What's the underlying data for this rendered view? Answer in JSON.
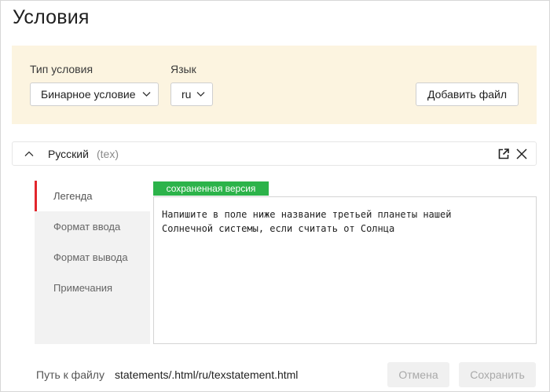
{
  "page": {
    "title": "Условия"
  },
  "settings": {
    "condition_type": {
      "label": "Тип условия",
      "value": "Бинарное условие"
    },
    "language": {
      "label": "Язык",
      "value": "ru"
    },
    "add_file_label": "Добавить файл"
  },
  "statement": {
    "language_name": "Русский",
    "format": "(tex)",
    "tabs": [
      {
        "label": "Легенда",
        "active": true
      },
      {
        "label": "Формат ввода",
        "active": false
      },
      {
        "label": "Формат вывода",
        "active": false
      },
      {
        "label": "Примечания",
        "active": false
      }
    ],
    "saved_badge": "сохраненная версия",
    "editor_text": "Напишите в поле ниже название третьей планеты нашей\nСолнечной системы, если считать от Солнца"
  },
  "footer": {
    "path_label": "Путь к файлу",
    "path_value": "statements/.html/ru/texstatement.html",
    "cancel_label": "Отмена",
    "save_label": "Сохранить"
  },
  "colors": {
    "panel_bg": "#fcf4e0",
    "active_tab_accent": "#e2262c",
    "saved_badge": "#2cb34a"
  },
  "icons": [
    "chevron-down-icon",
    "chevron-up-icon",
    "external-link-icon",
    "close-icon"
  ]
}
